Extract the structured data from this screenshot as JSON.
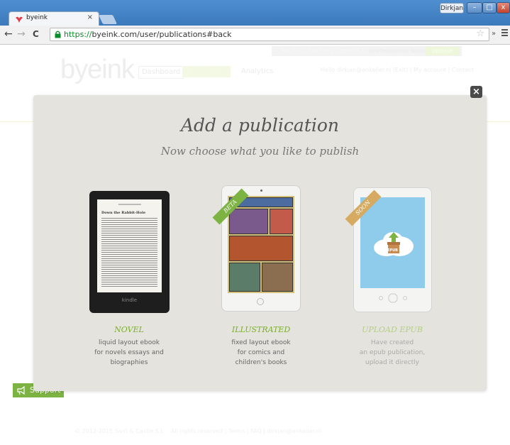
{
  "browser": {
    "tab_title": "byeink",
    "tab_close": "×",
    "window_user": "Dirkjan",
    "window_min": "–",
    "window_max": "□",
    "window_close": "x",
    "nav_back": "←",
    "nav_forward": "→",
    "nav_reload": "C",
    "url_scheme": "https://",
    "url_rest": "byeink.com/user/publications#back",
    "star": "☆",
    "ext": "»"
  },
  "page": {
    "upgrade_text": "You don't have any upgrade to",
    "upgrade_bold": "professional book",
    "upgrade_button": "Upgrade",
    "logo": "byeink",
    "nav": {
      "dashboard": "Dashboard",
      "publications": "Publications",
      "analytics": "Analytics"
    },
    "user_links": "Hello dirkjan@enkeiler.nl (Exit) | My account | Contact",
    "footer_text": "© 2012-2015 Sant & Castle S.L. · All rights reserved | Terms | FAQ | dirkjan@enkeiler.nl",
    "support_label": "Support"
  },
  "modal": {
    "close": "×",
    "title": "Add a publication",
    "subtitle": "Now choose what you like to publish",
    "options": [
      {
        "name": "NOVEL",
        "desc": "liquid layout ebook\nfor novels essays and\nbiographies",
        "device_label": "kindle",
        "chapter": "Down the Rabbit-Hole"
      },
      {
        "name": "ILLUSTRATED",
        "desc": "fixed layout ebook\nfor comics and\nchildren's books",
        "ribbon": "BETA"
      },
      {
        "name": "UPLOAD EPUB",
        "desc": "Have created\nan epub publication,\nupload it directly",
        "ribbon": "SOON",
        "badge": "EPUB"
      }
    ]
  },
  "colors": {
    "accent_green": "#7cb342",
    "modal_bg": "#e5e3dd",
    "soon_ribbon": "#d6aa60"
  }
}
